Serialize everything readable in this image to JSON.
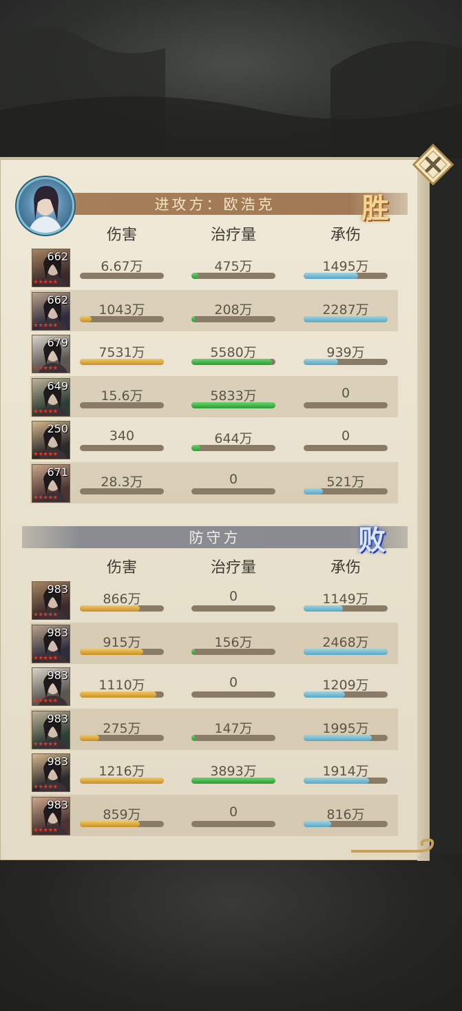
{
  "attacker": {
    "title": "进攻方：欧浩克",
    "result": "胜",
    "columns": [
      "伤害",
      "治疗量",
      "承伤"
    ],
    "rows": [
      {
        "level": "662",
        "damage": "6.67万",
        "heal": "475万",
        "taken": "1495万",
        "damage_pct": 0,
        "heal_pct": 0.08,
        "taken_pct": 0.65
      },
      {
        "level": "662",
        "damage": "1043万",
        "heal": "208万",
        "taken": "2287万",
        "damage_pct": 0.14,
        "heal_pct": 0.04,
        "taken_pct": 1.0
      },
      {
        "level": "679",
        "damage": "7531万",
        "heal": "5580万",
        "taken": "939万",
        "damage_pct": 1.0,
        "heal_pct": 0.96,
        "taken_pct": 0.41
      },
      {
        "level": "649",
        "damage": "15.6万",
        "heal": "5833万",
        "taken": "0",
        "damage_pct": 0,
        "heal_pct": 1.0,
        "taken_pct": 0
      },
      {
        "level": "250",
        "damage": "340",
        "heal": "644万",
        "taken": "0",
        "damage_pct": 0,
        "heal_pct": 0.11,
        "taken_pct": 0
      },
      {
        "level": "671",
        "damage": "28.3万",
        "heal": "0",
        "taken": "521万",
        "damage_pct": 0,
        "heal_pct": 0,
        "taken_pct": 0.23
      }
    ]
  },
  "defender": {
    "title": "防守方",
    "result": "败",
    "columns": [
      "伤害",
      "治疗量",
      "承伤"
    ],
    "rows": [
      {
        "level": "983",
        "damage": "866万",
        "heal": "0",
        "taken": "1149万",
        "damage_pct": 0.71,
        "heal_pct": 0,
        "taken_pct": 0.47
      },
      {
        "level": "983",
        "damage": "915万",
        "heal": "156万",
        "taken": "2468万",
        "damage_pct": 0.75,
        "heal_pct": 0.04,
        "taken_pct": 1.0
      },
      {
        "level": "983",
        "damage": "1110万",
        "heal": "0",
        "taken": "1209万",
        "damage_pct": 0.91,
        "heal_pct": 0,
        "taken_pct": 0.49
      },
      {
        "level": "983",
        "damage": "275万",
        "heal": "147万",
        "taken": "1995万",
        "damage_pct": 0.23,
        "heal_pct": 0.04,
        "taken_pct": 0.81
      },
      {
        "level": "983",
        "damage": "1216万",
        "heal": "3893万",
        "taken": "1914万",
        "damage_pct": 1.0,
        "heal_pct": 1.0,
        "taken_pct": 0.78
      },
      {
        "level": "983",
        "damage": "859万",
        "heal": "0",
        "taken": "816万",
        "damage_pct": 0.71,
        "heal_pct": 0,
        "taken_pct": 0.33
      }
    ]
  },
  "colors": {
    "damage": "#e0a93c",
    "heal": "#3fb447",
    "taken": "#6fb8d1",
    "bar_track": "#8a7b66"
  },
  "icons": {
    "close": "close-x-icon",
    "stars": "rank-star-icon"
  }
}
